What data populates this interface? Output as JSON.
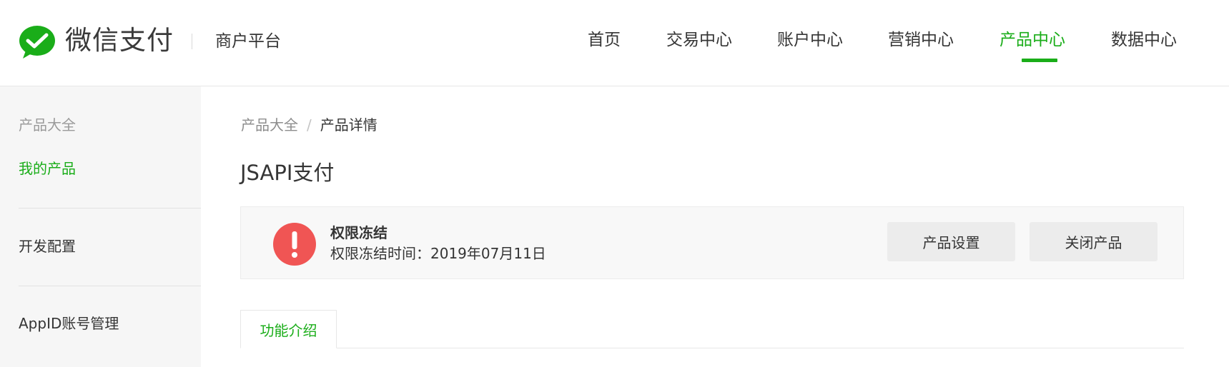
{
  "header": {
    "brand": "微信支付",
    "platform": "商户平台",
    "nav": [
      {
        "label": "首页"
      },
      {
        "label": "交易中心"
      },
      {
        "label": "账户中心"
      },
      {
        "label": "营销中心"
      },
      {
        "label": "产品中心",
        "active": true
      },
      {
        "label": "数据中心"
      }
    ]
  },
  "sidebar": {
    "items": [
      {
        "label": "产品大全"
      },
      {
        "label": "我的产品",
        "active": true
      },
      {
        "label": "开发配置"
      },
      {
        "label": "AppID账号管理"
      }
    ]
  },
  "breadcrumb": {
    "parent": "产品大全",
    "separator": "/",
    "current": "产品详情"
  },
  "page_title": "JSAPI支付",
  "status": {
    "title": "权限冻结",
    "detail": "权限冻结时间：2019年07月11日",
    "icon": "exclamation-icon",
    "icon_color": "#f05554"
  },
  "actions": {
    "settings_label": "产品设置",
    "close_label": "关闭产品"
  },
  "tabs": [
    {
      "label": "功能介绍",
      "active": true
    }
  ],
  "colors": {
    "accent": "#1aad19",
    "danger": "#f05554"
  }
}
